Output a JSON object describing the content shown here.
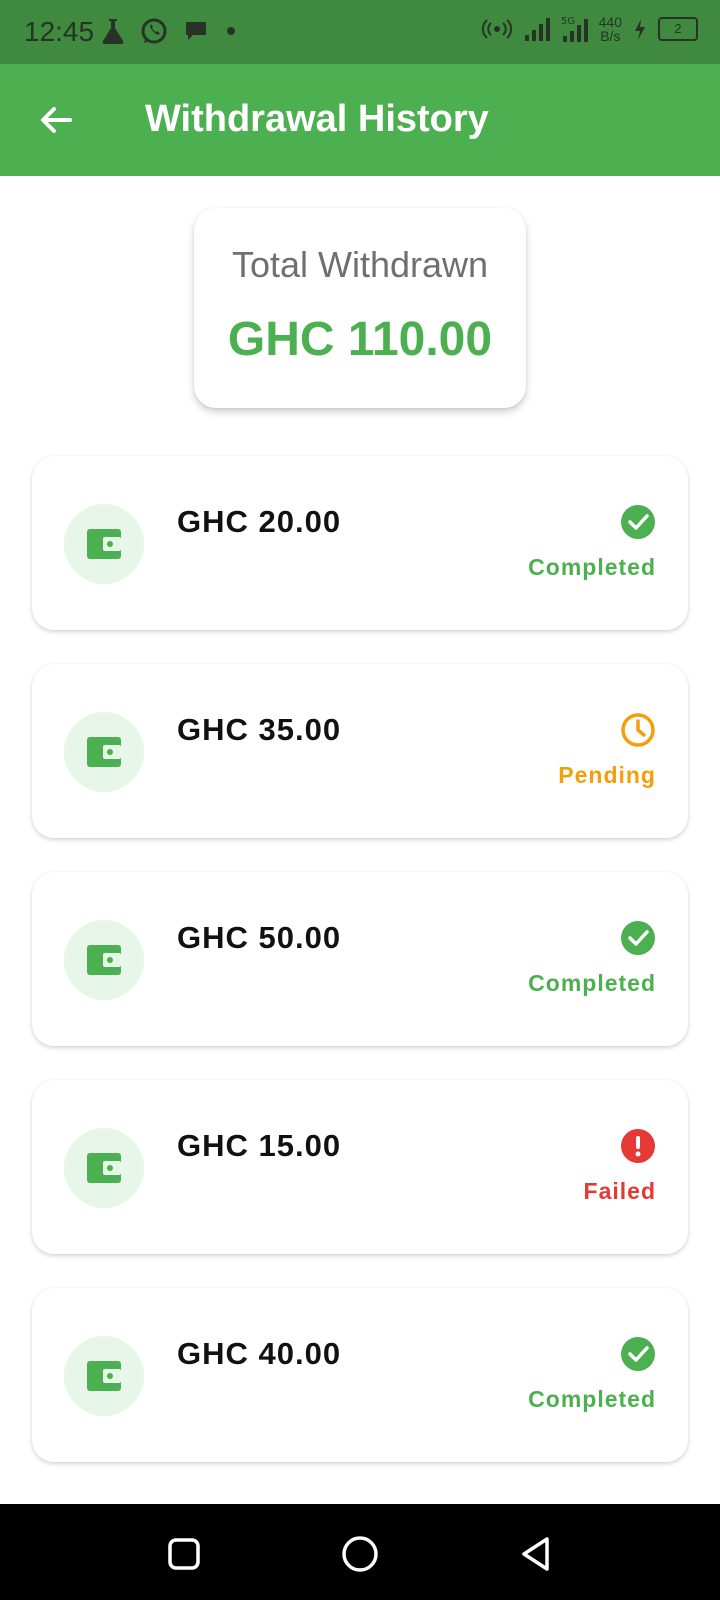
{
  "status_bar": {
    "time": "12:45",
    "net_speed_value": "440",
    "net_speed_unit": "B/s",
    "battery_level": "2",
    "icons": [
      "flask-icon",
      "whatsapp-icon",
      "message-icon",
      "dot-icon",
      "hotspot-icon",
      "signal-icon",
      "signal-5g-icon",
      "charging-icon",
      "battery-icon"
    ]
  },
  "app_bar": {
    "title": "Withdrawal History",
    "back_icon": "arrow-left-icon"
  },
  "summary": {
    "label": "Total Withdrawn",
    "amount": "GHC 110.00"
  },
  "colors": {
    "primary": "#4caf50",
    "completed": "#4caf50",
    "pending": "#f59e0b",
    "failed": "#e53935",
    "wallet_bg": "#e8f5e9"
  },
  "withdrawals": [
    {
      "amount": "GHC 20.00",
      "status": "Completed",
      "status_icon": "check-circle-icon"
    },
    {
      "amount": "GHC 35.00",
      "status": "Pending",
      "status_icon": "clock-icon"
    },
    {
      "amount": "GHC 50.00",
      "status": "Completed",
      "status_icon": "check-circle-icon"
    },
    {
      "amount": "GHC 15.00",
      "status": "Failed",
      "status_icon": "error-circle-icon"
    },
    {
      "amount": "GHC 40.00",
      "status": "Completed",
      "status_icon": "check-circle-icon"
    }
  ],
  "nav_bar": {
    "icons": [
      "recents-square-icon",
      "home-circle-icon",
      "back-triangle-icon"
    ]
  }
}
